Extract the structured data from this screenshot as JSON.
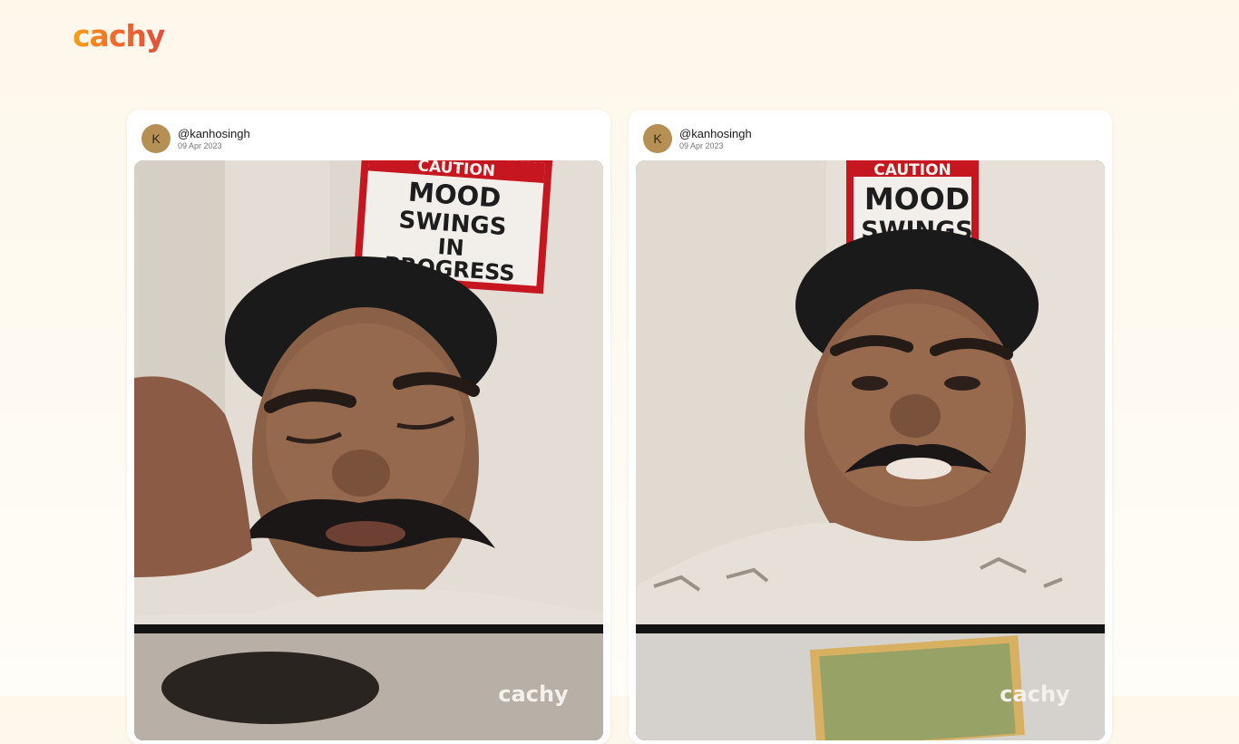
{
  "brand": {
    "logo_text": "cachy"
  },
  "posts": [
    {
      "avatar_initial": "K",
      "username": "@kanhosingh",
      "date": "09 Apr 2023",
      "sign_lines": [
        "CAUTION",
        "MOOD",
        "SWINGS",
        "IN",
        "PROGRESS"
      ],
      "watermark": "cachy"
    },
    {
      "avatar_initial": "K",
      "username": "@kanhosingh",
      "date": "09 Apr 2023",
      "sign_lines": [
        "CAUTION",
        "MOOD",
        "SWINGS"
      ],
      "watermark": "cachy"
    }
  ]
}
